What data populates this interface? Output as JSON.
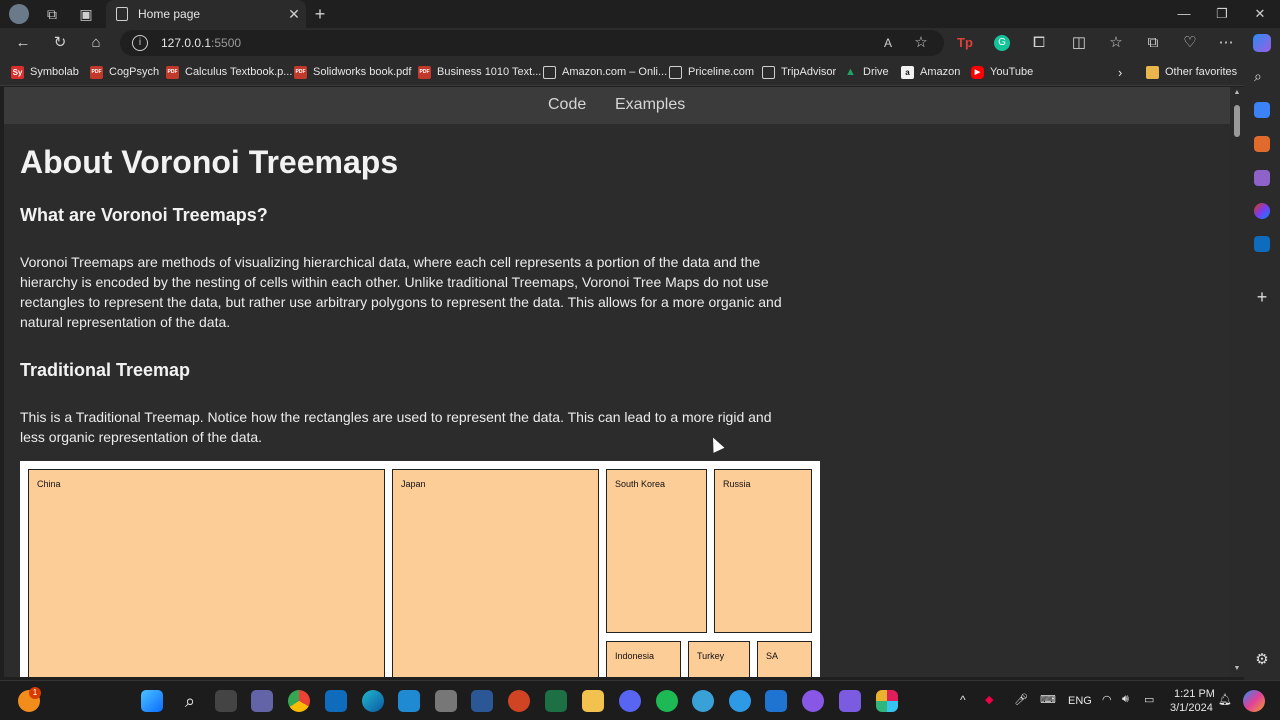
{
  "browser": {
    "tab_title": "Home page",
    "url_host": "127.0.0.1",
    "url_port": ":5500",
    "bookmarks": [
      {
        "label": "Symbolab",
        "icon": "symbolab-icon",
        "color": "#d9302e",
        "glyph": "Sy"
      },
      {
        "label": "CogPsych",
        "icon": "pdf-icon",
        "color": "#c0392b",
        "glyph": "PDF"
      },
      {
        "label": "Calculus Textbook.p...",
        "icon": "pdf-icon",
        "color": "#c0392b",
        "glyph": "PDF"
      },
      {
        "label": "Solidworks book.pdf",
        "icon": "pdf-icon",
        "color": "#c0392b",
        "glyph": "PDF"
      },
      {
        "label": "Business 1010 Text...",
        "icon": "pdf-icon",
        "color": "#c0392b",
        "glyph": "PDF"
      },
      {
        "label": "Amazon.com – Onli...",
        "icon": "page-icon",
        "color": "#2b2b2b",
        "glyph": ""
      },
      {
        "label": "Priceline.com",
        "icon": "page-icon",
        "color": "#2b2b2b",
        "glyph": ""
      },
      {
        "label": "TripAdvisor",
        "icon": "page-icon",
        "color": "#2b2b2b",
        "glyph": ""
      },
      {
        "label": "Drive",
        "icon": "drive-icon",
        "color": "#1fa463",
        "glyph": "▲"
      },
      {
        "label": "Amazon",
        "icon": "amazon-icon",
        "color": "#f2f2f2",
        "glyph": "a"
      },
      {
        "label": "YouTube",
        "icon": "youtube-icon",
        "color": "#ff0000",
        "glyph": "▶"
      }
    ],
    "other_favorites": "Other favorites"
  },
  "site_nav": {
    "code": "Code",
    "examples": "Examples"
  },
  "page": {
    "title": "About Voronoi Treemaps",
    "section1_heading": "What are Voronoi Treemaps?",
    "section1_body": "Voronoi Treemaps are methods of visualizing hierarchical data, where each cell represents a portion of the data and the hierarchy is encoded by the nesting of cells within each other. Unlike traditional Treemaps, Voronoi Tree Maps do not use rectangles to represent the data, but rather use arbitrary polygons to represent the data. This allows for a more organic and natural representation of the data.",
    "section2_heading": "Traditional Treemap",
    "section2_body": "This is a Traditional Treemap. Notice how the rectangles are used to represent the data. This can lead to a more rigid and less organic representation of the data.",
    "treemap_labels": {
      "china": "China",
      "japan": "Japan",
      "south_korea": "South Korea",
      "russia": "Russia",
      "indonesia": "Indonesia",
      "turkey": "Turkey",
      "sa": "SA"
    },
    "treemap_fill": "#fdcd98"
  },
  "taskbar": {
    "time": "1:21 PM",
    "date": "3/1/2024",
    "language": "ENG",
    "notification_badge": "1"
  }
}
